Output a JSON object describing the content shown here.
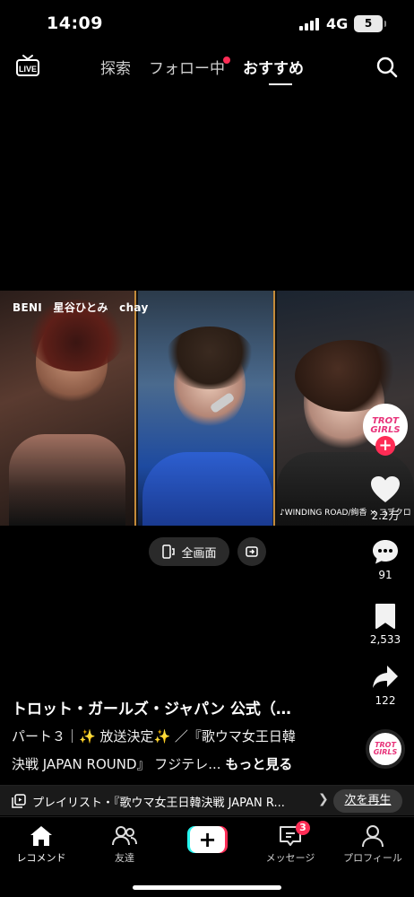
{
  "status_bar": {
    "time": "14:09",
    "network": "4G",
    "battery": "5"
  },
  "top_nav": {
    "tabs": [
      {
        "label": "探索"
      },
      {
        "label": "フォロー中",
        "has_dot": true
      },
      {
        "label": "おすすめ",
        "active": true
      }
    ],
    "live_icon": "live-tv-icon",
    "search_icon": "search-icon"
  },
  "video": {
    "overlay_names": [
      "BENI",
      "星谷ひとみ",
      "chay"
    ],
    "song_caption": "♪WINDING ROAD/絢香 × コブクロ"
  },
  "video_controls": {
    "fullscreen_label": "全画面"
  },
  "actions": {
    "avatar_logo": "TROT GIRLS",
    "likes": "2.2万",
    "comments": "91",
    "saves": "2,533",
    "shares": "122"
  },
  "description": {
    "title": "トロット・ガールズ・ジャパン 公式（…",
    "line1": "パート３｜✨ 放送決定✨ ／『歌ウマ女王日韓",
    "line2": "決戦 JAPAN ROUND』 フジテレ...",
    "more": "もっと見る"
  },
  "playlist": {
    "text": "プレイリスト・『歌ウマ女王日韓決戦 JAPAN R...",
    "next_label": "次を再生"
  },
  "bottom_nav": {
    "items": [
      {
        "label": "レコメンド",
        "active": true
      },
      {
        "label": "友達"
      },
      {
        "label": "メッセージ",
        "badge": "3"
      },
      {
        "label": "プロフィール"
      }
    ]
  },
  "colors": {
    "accent": "#fe2c55",
    "create_cyan": "#25f4ee",
    "background": "#000000"
  }
}
